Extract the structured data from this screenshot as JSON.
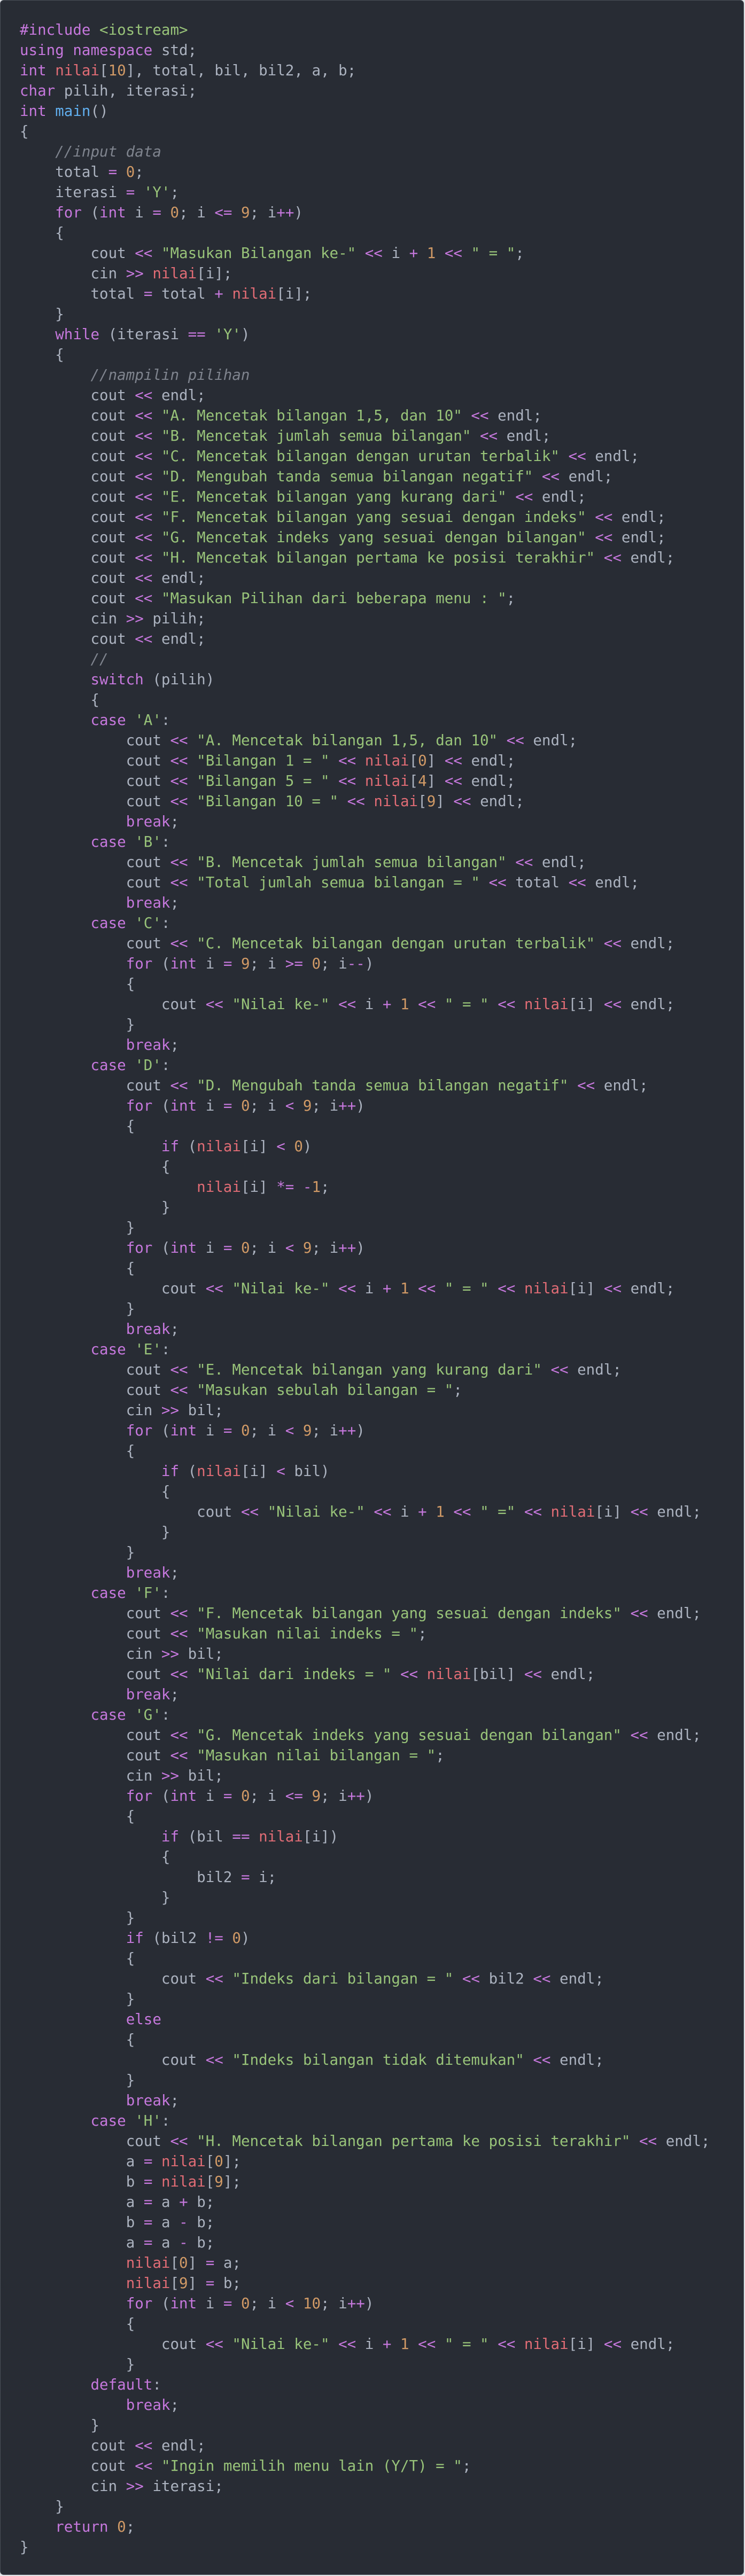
{
  "code_lines": [
    "#include <iostream>",
    "using namespace std;",
    "int nilai[10], total, bil, bil2, a, b;",
    "char pilih, iterasi;",
    "int main()",
    "{",
    "    //input data",
    "    total = 0;",
    "    iterasi = 'Y';",
    "    for (int i = 0; i <= 9; i++)",
    "    {",
    "        cout << \"Masukan Bilangan ke-\" << i + 1 << \" = \";",
    "        cin >> nilai[i];",
    "        total = total + nilai[i];",
    "    }",
    "    while (iterasi == 'Y')",
    "    {",
    "        //nampilin pilihan",
    "        cout << endl;",
    "        cout << \"A. Mencetak bilangan 1,5, dan 10\" << endl;",
    "        cout << \"B. Mencetak jumlah semua bilangan\" << endl;",
    "        cout << \"C. Mencetak bilangan dengan urutan terbalik\" << endl;",
    "        cout << \"D. Mengubah tanda semua bilangan negatif\" << endl;",
    "        cout << \"E. Mencetak bilangan yang kurang dari\" << endl;",
    "        cout << \"F. Mencetak bilangan yang sesuai dengan indeks\" << endl;",
    "        cout << \"G. Mencetak indeks yang sesuai dengan bilangan\" << endl;",
    "        cout << \"H. Mencetak bilangan pertama ke posisi terakhir\" << endl;",
    "        cout << endl;",
    "        cout << \"Masukan Pilihan dari beberapa menu : \";",
    "        cin >> pilih;",
    "        cout << endl;",
    "        //",
    "        switch (pilih)",
    "        {",
    "        case 'A':",
    "            cout << \"A. Mencetak bilangan 1,5, dan 10\" << endl;",
    "            cout << \"Bilangan 1 = \" << nilai[0] << endl;",
    "            cout << \"Bilangan 5 = \" << nilai[4] << endl;",
    "            cout << \"Bilangan 10 = \" << nilai[9] << endl;",
    "            break;",
    "        case 'B':",
    "            cout << \"B. Mencetak jumlah semua bilangan\" << endl;",
    "            cout << \"Total jumlah semua bilangan = \" << total << endl;",
    "            break;",
    "        case 'C':",
    "            cout << \"C. Mencetak bilangan dengan urutan terbalik\" << endl;",
    "            for (int i = 9; i >= 0; i--)",
    "            {",
    "                cout << \"Nilai ke-\" << i + 1 << \" = \" << nilai[i] << endl;",
    "            }",
    "            break;",
    "        case 'D':",
    "            cout << \"D. Mengubah tanda semua bilangan negatif\" << endl;",
    "            for (int i = 0; i < 9; i++)",
    "            {",
    "                if (nilai[i] < 0)",
    "                {",
    "                    nilai[i] *= -1;",
    "                }",
    "            }",
    "            for (int i = 0; i < 9; i++)",
    "            {",
    "                cout << \"Nilai ke-\" << i + 1 << \" = \" << nilai[i] << endl;",
    "            }",
    "            break;",
    "        case 'E':",
    "            cout << \"E. Mencetak bilangan yang kurang dari\" << endl;",
    "            cout << \"Masukan sebulah bilangan = \";",
    "            cin >> bil;",
    "            for (int i = 0; i < 9; i++)",
    "            {",
    "                if (nilai[i] < bil)",
    "                {",
    "                    cout << \"Nilai ke-\" << i + 1 << \" =\" << nilai[i] << endl;",
    "                }",
    "            }",
    "            break;",
    "        case 'F':",
    "            cout << \"F. Mencetak bilangan yang sesuai dengan indeks\" << endl;",
    "            cout << \"Masukan nilai indeks = \";",
    "            cin >> bil;",
    "            cout << \"Nilai dari indeks = \" << nilai[bil] << endl;",
    "            break;",
    "        case 'G':",
    "            cout << \"G. Mencetak indeks yang sesuai dengan bilangan\" << endl;",
    "            cout << \"Masukan nilai bilangan = \";",
    "            cin >> bil;",
    "            for (int i = 0; i <= 9; i++)",
    "            {",
    "                if (bil == nilai[i])",
    "                {",
    "                    bil2 = i;",
    "                }",
    "            }",
    "            if (bil2 != 0)",
    "            {",
    "                cout << \"Indeks dari bilangan = \" << bil2 << endl;",
    "            }",
    "            else",
    "            {",
    "                cout << \"Indeks bilangan tidak ditemukan\" << endl;",
    "            }",
    "            break;",
    "        case 'H':",
    "            cout << \"H. Mencetak bilangan pertama ke posisi terakhir\" << endl;",
    "            a = nilai[0];",
    "            b = nilai[9];",
    "            a = a + b;",
    "            b = a - b;",
    "            a = a - b;",
    "            nilai[0] = a;",
    "            nilai[9] = b;",
    "            for (int i = 0; i < 10; i++)",
    "            {",
    "                cout << \"Nilai ke-\" << i + 1 << \" = \" << nilai[i] << endl;",
    "            }",
    "        default:",
    "            break;",
    "        }",
    "        cout << endl;",
    "        cout << \"Ingin memilih menu lain (Y/T) = \";",
    "        cin >> iterasi;",
    "    }",
    "    return 0;",
    "}"
  ],
  "theme": {
    "background": "#282c34",
    "text": "#abb2bf",
    "keyword": "#c678dd",
    "string": "#98c379",
    "number": "#d19a66",
    "variable": "#e06c75",
    "function": "#61afef",
    "comment": "#7f848e"
  }
}
